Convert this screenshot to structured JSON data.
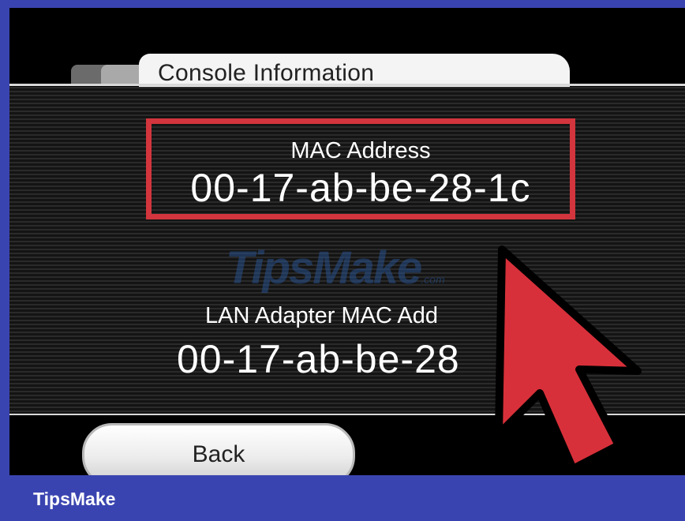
{
  "tab": {
    "title": "Console Information"
  },
  "mac": {
    "label": "MAC Address",
    "value": "00-17-ab-be-28-1c"
  },
  "lan": {
    "label": "LAN Adapter MAC Add",
    "value": "00-17-ab-be-28"
  },
  "watermark": {
    "text": "TipsMake",
    "suffix": ".com"
  },
  "buttons": {
    "back_label": "Back"
  },
  "footer": {
    "brand": "TipsMake"
  },
  "colors": {
    "frame": "#3a44b0",
    "highlight": "#d2353d",
    "cursor": "#d8303a"
  },
  "icons": {
    "cursor": "pointer-arrow-icon"
  }
}
